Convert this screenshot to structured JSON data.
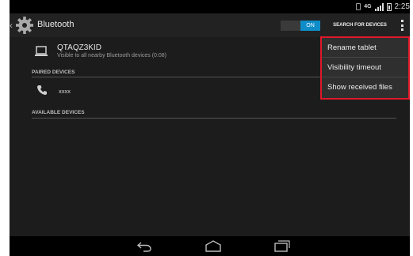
{
  "status_bar": {
    "network": "4G",
    "time": "2:25",
    "icons": [
      "vibrate-icon",
      "network-4g-icon",
      "signal-icon",
      "battery-icon"
    ]
  },
  "action_bar": {
    "title": "Bluetooth",
    "toggle_label": "ON",
    "search_label": "SEARCH FOR DEVICES",
    "accent": "#0e8dc9"
  },
  "this_device": {
    "name": "QTAQZ3KID",
    "visibility": "Visible to all nearby Bluetooth devices (0:08)"
  },
  "sections": {
    "paired": "PAIRED DEVICES",
    "available": "AVAILABLE DEVICES"
  },
  "paired_devices": [
    {
      "name": "xxxx",
      "icon": "phone-icon"
    }
  ],
  "overflow_menu": {
    "items": [
      "Rename tablet",
      "Visibility timeout",
      "Show received files"
    ],
    "highlight_color": "#e0182a"
  }
}
